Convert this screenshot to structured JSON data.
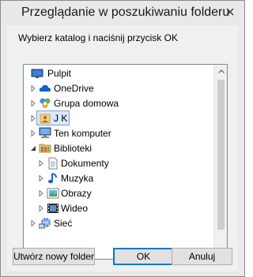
{
  "window": {
    "title": "Przeglądanie w poszukiwaniu folderu"
  },
  "instruction": "Wybierz katalog i naciśnij przycisk OK",
  "tree": {
    "items": [
      {
        "label": "Pulpit",
        "icon": "desktop-icon",
        "level": 0,
        "expander": "none"
      },
      {
        "label": "OneDrive",
        "icon": "onedrive-cloud-icon",
        "level": 1,
        "expander": "collapsed"
      },
      {
        "label": "Grupa domowa",
        "icon": "homegroup-icon",
        "level": 1,
        "expander": "collapsed"
      },
      {
        "label": "J K",
        "icon": "user-folder-icon",
        "level": 1,
        "expander": "collapsed",
        "selected": true
      },
      {
        "label": "Ten komputer",
        "icon": "computer-icon",
        "level": 1,
        "expander": "collapsed"
      },
      {
        "label": "Biblioteki",
        "icon": "libraries-icon",
        "level": 1,
        "expander": "expanded"
      },
      {
        "label": "Dokumenty",
        "icon": "documents-icon",
        "level": 2,
        "expander": "collapsed"
      },
      {
        "label": "Muzyka",
        "icon": "music-icon",
        "level": 2,
        "expander": "collapsed"
      },
      {
        "label": "Obrazy",
        "icon": "pictures-icon",
        "level": 2,
        "expander": "collapsed"
      },
      {
        "label": "Wideo",
        "icon": "videos-icon",
        "level": 2,
        "expander": "collapsed"
      },
      {
        "label": "Sieć",
        "icon": "network-icon",
        "level": 1,
        "expander": "collapsed"
      }
    ]
  },
  "buttons": {
    "new_folder": "Utwórz nowy folder",
    "ok": "OK",
    "cancel": "Anuluj"
  },
  "colors": {
    "selection_fill": "#d9e8fb",
    "selection_border": "#7da2ce",
    "default_button_border": "#0078d7"
  }
}
